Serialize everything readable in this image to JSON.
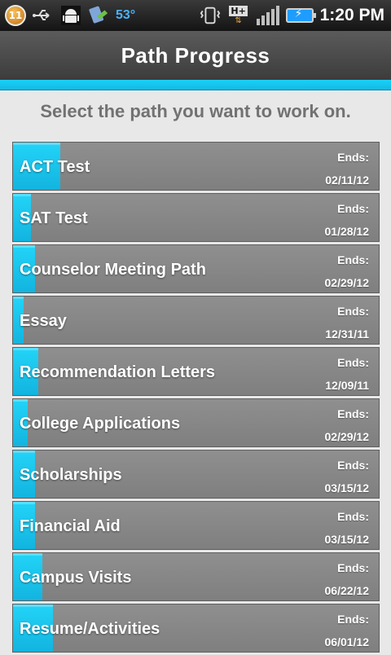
{
  "status_bar": {
    "notification_count": "11",
    "temperature": "53°",
    "network_label": "H+",
    "time": "1:20 PM",
    "icons": [
      "notification-badge-icon",
      "usb-icon",
      "android-debug-icon",
      "weather-icon",
      "vibrate-icon",
      "network-hplus-icon",
      "signal-icon",
      "battery-charging-icon"
    ]
  },
  "header": {
    "title": "Path Progress"
  },
  "instruction": "Select the path you want to work on.",
  "paths": [
    {
      "name": "ACT Test",
      "ends_label": "Ends:",
      "end_date": "02/11/12",
      "progress": 0.13
    },
    {
      "name": "SAT Test",
      "ends_label": "Ends:",
      "end_date": "01/28/12",
      "progress": 0.05
    },
    {
      "name": "Counselor Meeting Path",
      "ends_label": "Ends:",
      "end_date": "02/29/12",
      "progress": 0.06
    },
    {
      "name": "Essay",
      "ends_label": "Ends:",
      "end_date": "12/31/11",
      "progress": 0.03
    },
    {
      "name": "Recommendation Letters",
      "ends_label": "Ends:",
      "end_date": "12/09/11",
      "progress": 0.07
    },
    {
      "name": "College Applications",
      "ends_label": "Ends:",
      "end_date": "02/29/12",
      "progress": 0.04
    },
    {
      "name": "Scholarships",
      "ends_label": "Ends:",
      "end_date": "03/15/12",
      "progress": 0.06
    },
    {
      "name": "Financial Aid",
      "ends_label": "Ends:",
      "end_date": "03/15/12",
      "progress": 0.06
    },
    {
      "name": "Campus Visits",
      "ends_label": "Ends:",
      "end_date": "06/22/12",
      "progress": 0.08
    },
    {
      "name": "Resume/Activities",
      "ends_label": "Ends:",
      "end_date": "06/01/12",
      "progress": 0.11
    }
  ],
  "colors": {
    "accent": "#1bc8f2",
    "item_bg": "#888888",
    "title_bg": "#4a4a4a"
  }
}
